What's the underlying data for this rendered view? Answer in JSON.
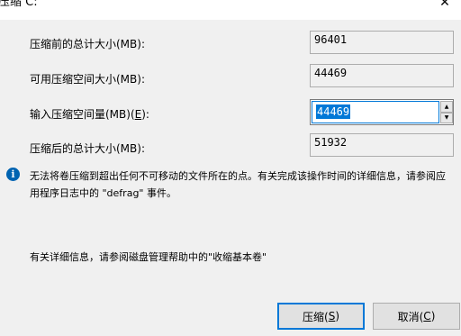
{
  "window": {
    "title": "压缩 C:",
    "close_glyph": "✕"
  },
  "rows": {
    "total_before": {
      "label": "压缩前的总计大小(MB):",
      "value": "96401"
    },
    "available": {
      "label": "可用压缩空间大小(MB):",
      "value": "44469"
    },
    "amount": {
      "label_prefix": "输入压缩空间量(MB)(",
      "label_key": "E",
      "label_suffix": "):",
      "value": "44469"
    },
    "total_after": {
      "label": "压缩后的总计大小(MB):",
      "value": "51932"
    }
  },
  "info": {
    "icon": "info-icon",
    "icon_glyph": "i",
    "message": "无法将卷压缩到超出任何不可移动的文件所在的点。有关完成该操作时间的详细信息，请参阅应用程序日志中的 \"defrag\" 事件。"
  },
  "details": "有关详细信息，请参阅磁盘管理帮助中的\"收缩基本卷\"",
  "buttons": {
    "shrink": {
      "prefix": "压缩(",
      "key": "S",
      "suffix": ")"
    },
    "cancel": {
      "prefix": "取消(",
      "key": "C",
      "suffix": ")"
    }
  },
  "spinner": {
    "up_glyph": "▲",
    "down_glyph": "▼"
  },
  "colors": {
    "accent": "#0078d7",
    "info_icon": "#0063b1",
    "dialog_bg": "#f0f0f0"
  }
}
